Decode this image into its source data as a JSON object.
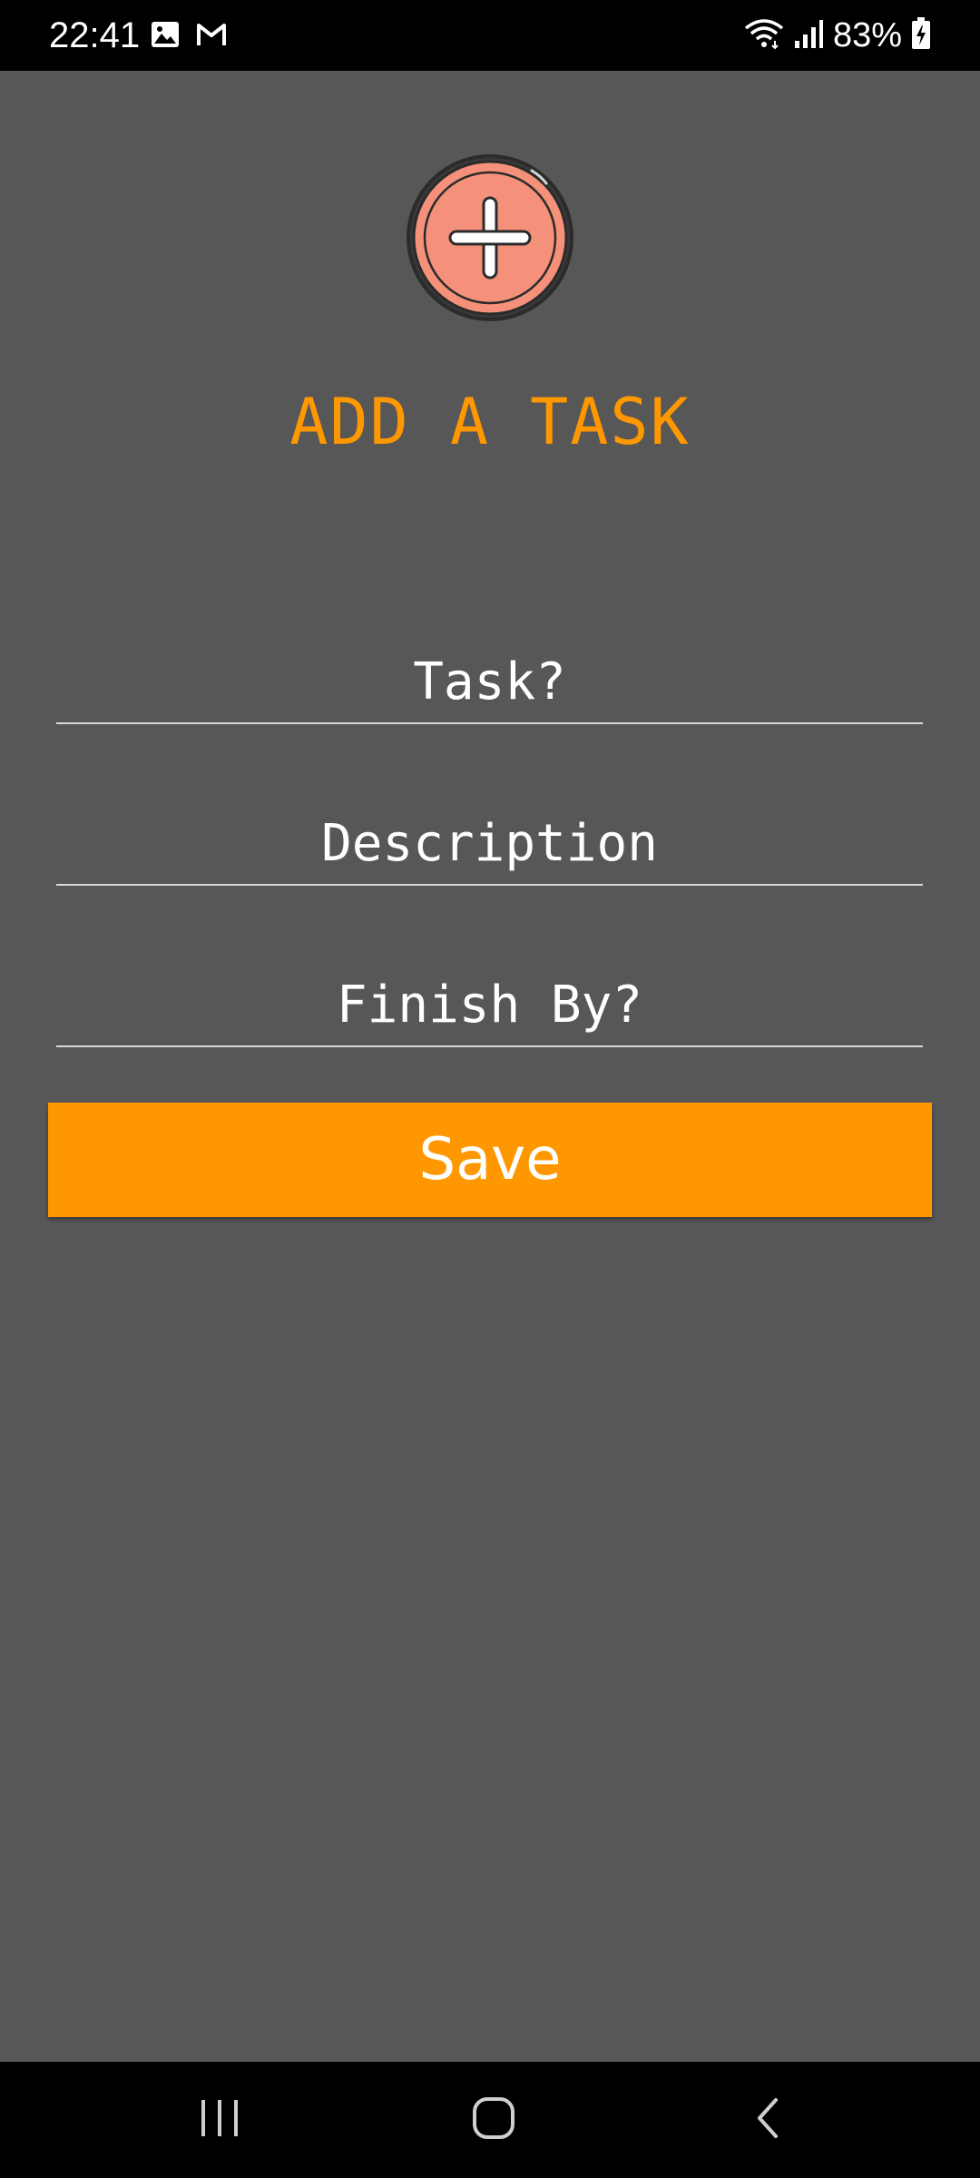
{
  "status_bar": {
    "time": "22:41",
    "left_icons": [
      "image-icon",
      "gmail-icon"
    ],
    "right_icons": [
      "wifi-icon",
      "signal-icon",
      "battery-charging-icon"
    ],
    "battery_text": "83%"
  },
  "header": {
    "icon": "add-circle-icon",
    "title": "ADD A TASK",
    "colors": {
      "title": "#ff9800",
      "icon_fill": "#f5917a",
      "icon_outline": "#2b2b2b"
    }
  },
  "form": {
    "task": {
      "value": "",
      "placeholder": "Task?"
    },
    "description": {
      "value": "",
      "placeholder": "Description"
    },
    "finish_by": {
      "value": "",
      "placeholder": "Finish By?"
    },
    "save_label": "Save"
  },
  "theme": {
    "background": "#575757",
    "accent": "#ff9800",
    "text": "#ffffff"
  },
  "nav_bar": {
    "buttons": [
      "recents-icon",
      "home-icon",
      "back-icon"
    ]
  }
}
